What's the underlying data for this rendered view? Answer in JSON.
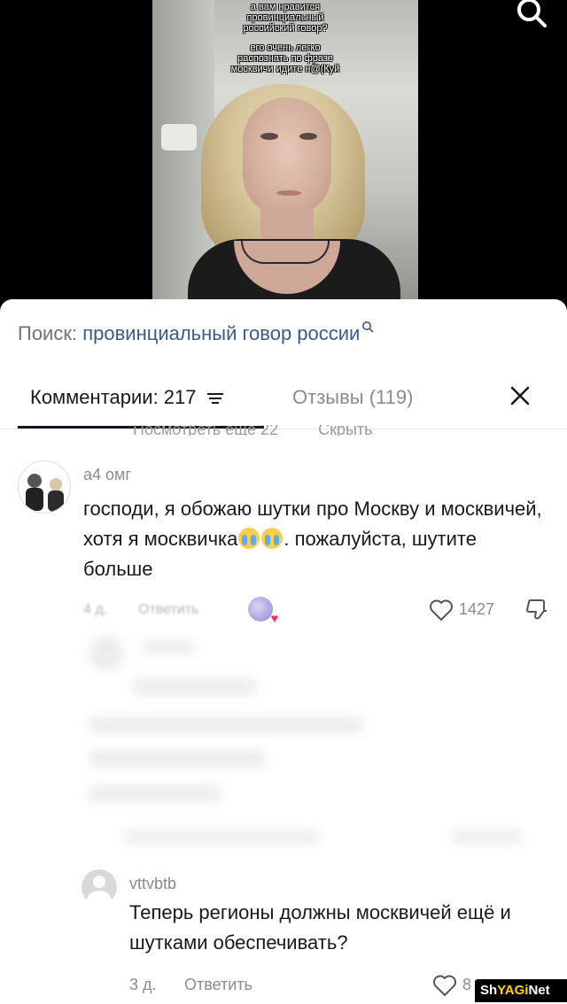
{
  "video": {
    "caption_lines": [
      "а вам нравится",
      "провинциальный",
      "российский говор?"
    ],
    "caption_lines2": [
      "его очень легко",
      "распознать по фразе",
      "москвичи идите н@(Куй"
    ]
  },
  "search": {
    "prefix": "Поиск:",
    "query": "провинциальный говор россии"
  },
  "tabs": {
    "comments_label": "Комментарии: 217",
    "reviews_label": "Отзывы (119)"
  },
  "cut_off_row": {
    "view_more": "Посмотреть ещё 22",
    "hide": "Скрыть"
  },
  "comments": [
    {
      "username": "а4 омг",
      "text_before_emoji": "господи, я обожаю шутки про Москву и москвичей, хотя я москвичка",
      "text_after_emoji": ". пожалуйста, шутите больше",
      "emoji": "loudly-crying-face",
      "date": "4 д.",
      "reply": "Ответить",
      "likes": "1427"
    },
    {
      "username": "vttvbtb",
      "text": "Теперь регионы должны москвичей ещё и шутками обеспечивать?",
      "date": "3 д.",
      "reply": "Ответить",
      "likes": "8"
    }
  ],
  "watermark": {
    "part1": "Sh",
    "part2": "YAGi",
    "part3": "Net"
  },
  "colors": {
    "accent_link": "#3a5a8c",
    "text_primary": "#161823",
    "text_secondary": "#8a8b91",
    "watermark_yellow": "#ffd400"
  }
}
